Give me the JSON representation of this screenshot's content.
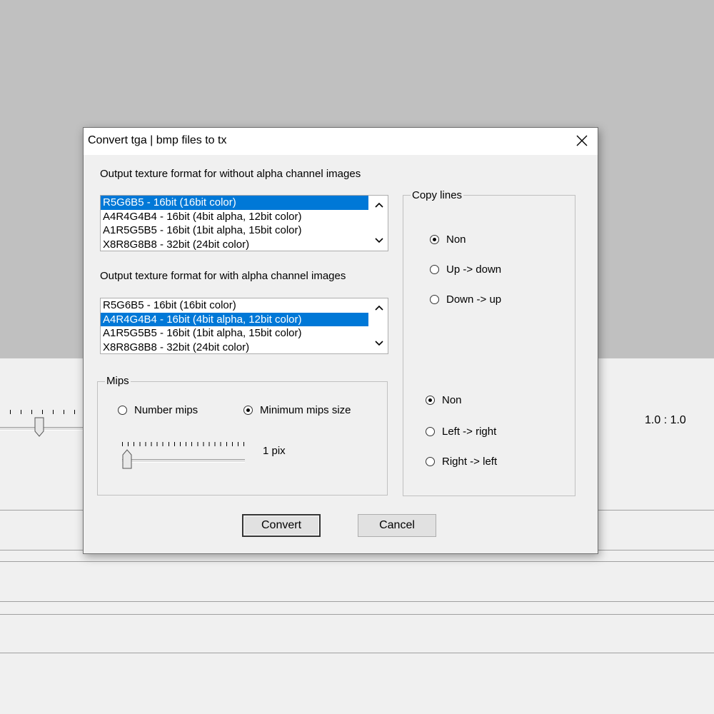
{
  "background": {
    "ratio_text": "1.0 : 1.0"
  },
  "dialog": {
    "title": "Convert tga | bmp files to tx",
    "no_alpha_label": "Output texture format for without alpha channel images",
    "with_alpha_label": "Output texture format for with alpha channel images",
    "formats": [
      "R5G6B5 - 16bit (16bit color)",
      "A4R4G4B4 - 16bit (4bit alpha, 12bit color)",
      "A1R5G5B5 - 16bit (1bit alpha, 15bit color)",
      "X8R8G8B8 - 32bit (24bit color)"
    ],
    "no_alpha_selected": 0,
    "with_alpha_selected": 1,
    "mips": {
      "title": "Mips",
      "number_mips": "Number mips",
      "minimum_mips_size": "Minimum mips size",
      "selected": "minimum_mips_size",
      "size_value": "1 pix",
      "slider_fraction": 0
    },
    "copy_lines": {
      "title": "Copy lines",
      "vertical": [
        "Non",
        "Up -> down",
        "Down -> up"
      ],
      "vertical_selected": 0,
      "horizontal": [
        "Non",
        "Left -> right",
        "Right -> left"
      ],
      "horizontal_selected": 0
    },
    "convert_label": "Convert",
    "cancel_label": "Cancel"
  },
  "colors": {
    "selection": "#0078d7",
    "dialog_bg": "#f0f0f0",
    "backdrop": "#c0c0c0"
  }
}
